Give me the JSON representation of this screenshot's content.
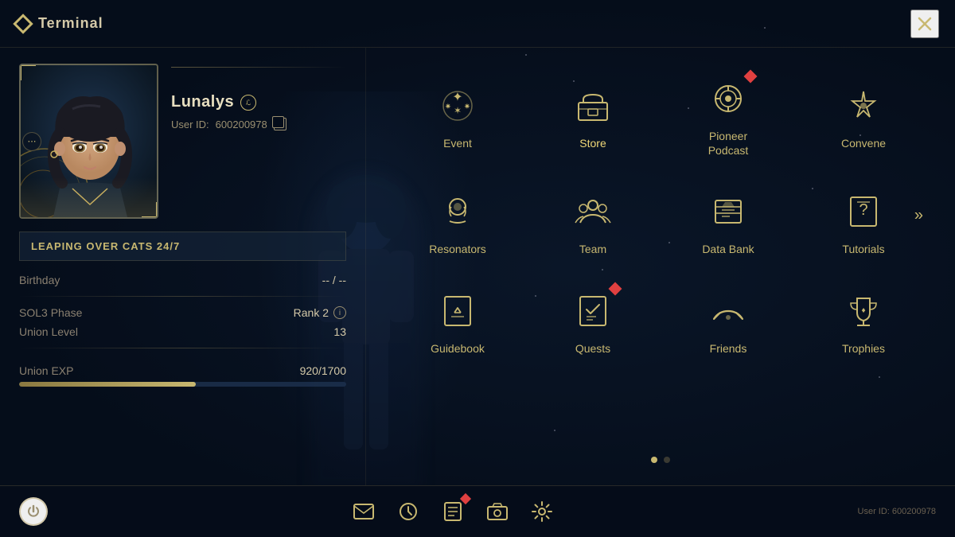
{
  "terminal": {
    "title": "Terminal",
    "close_label": "✕"
  },
  "profile": {
    "name": "Lunalys",
    "user_id_label": "User ID:",
    "user_id": "600200978",
    "guild": "LEAPING OVER CATS 24/7",
    "birthday_label": "Birthday",
    "birthday_value": "-- / --",
    "sol3_label": "SOL3 Phase",
    "sol3_value": "Rank 2",
    "union_level_label": "Union Level",
    "union_level_value": "13",
    "union_exp_label": "Union EXP",
    "union_exp_value": "920/1700",
    "union_exp_pct": 54
  },
  "menu_items": [
    {
      "id": "event",
      "label": "Event",
      "notification": false,
      "notification_type": null,
      "active": false
    },
    {
      "id": "store",
      "label": "Store",
      "notification": false,
      "notification_type": null,
      "active": true
    },
    {
      "id": "pioneer-podcast",
      "label": "Pioneer\nPodcast",
      "notification": true,
      "notification_type": "diamond",
      "active": false
    },
    {
      "id": "convene",
      "label": "Convene",
      "notification": false,
      "notification_type": null,
      "active": false
    },
    {
      "id": "resonators",
      "label": "Resonators",
      "notification": false,
      "notification_type": null,
      "active": false
    },
    {
      "id": "team",
      "label": "Team",
      "notification": false,
      "notification_type": null,
      "active": false
    },
    {
      "id": "data-bank",
      "label": "Data Bank",
      "notification": false,
      "notification_type": null,
      "active": false
    },
    {
      "id": "tutorials",
      "label": "Tutorials",
      "notification": false,
      "notification_type": null,
      "active": false
    },
    {
      "id": "guidebook",
      "label": "Guidebook",
      "notification": false,
      "notification_type": null,
      "active": false
    },
    {
      "id": "quests",
      "label": "Quests",
      "notification": true,
      "notification_type": "diamond",
      "active": false
    },
    {
      "id": "friends",
      "label": "Friends",
      "notification": false,
      "notification_type": null,
      "active": false
    },
    {
      "id": "trophies",
      "label": "Trophies",
      "notification": false,
      "notification_type": null,
      "active": false
    }
  ],
  "pagination": {
    "current": 0,
    "total": 2
  },
  "bottom_bar": {
    "user_id_label": "User ID: 600200978"
  }
}
